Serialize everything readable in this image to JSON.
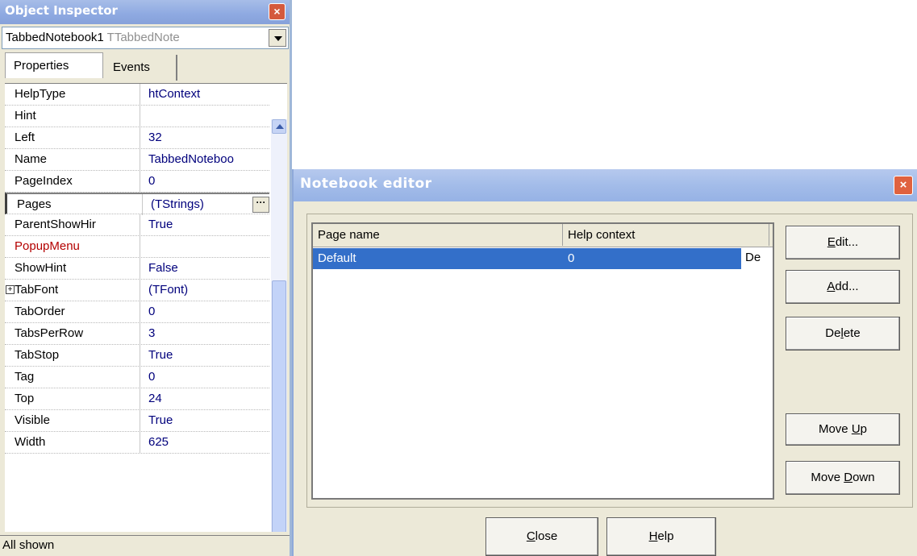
{
  "object_inspector": {
    "title": "Object Inspector",
    "close_glyph": "×",
    "component_name": "TabbedNotebook1",
    "component_type": "TTabbedNote",
    "tabs": [
      "Properties",
      "Events"
    ],
    "properties": [
      {
        "name": "HelpType",
        "value": "htContext"
      },
      {
        "name": "Hint",
        "value": ""
      },
      {
        "name": "Left",
        "value": "32"
      },
      {
        "name": "Name",
        "value": "TabbedNoteboo"
      },
      {
        "name": "PageIndex",
        "value": "0"
      },
      {
        "name": "Pages",
        "value": "(TStrings)"
      },
      {
        "name": "ParentShowHir",
        "value": "True"
      },
      {
        "name": "PopupMenu",
        "value": ""
      },
      {
        "name": "ShowHint",
        "value": "False"
      },
      {
        "name": "TabFont",
        "value": "(TFont)"
      },
      {
        "name": "TabOrder",
        "value": "0"
      },
      {
        "name": "TabsPerRow",
        "value": "3"
      },
      {
        "name": "TabStop",
        "value": "True"
      },
      {
        "name": "Tag",
        "value": "0"
      },
      {
        "name": "Top",
        "value": "24"
      },
      {
        "name": "Visible",
        "value": "True"
      },
      {
        "name": "Width",
        "value": "625"
      }
    ],
    "status": "All shown"
  },
  "notebook_editor": {
    "title": "Notebook editor",
    "close_glyph": "×",
    "columns": [
      "Page name",
      "Help context"
    ],
    "rows": [
      {
        "page_name": "Default",
        "help_context": "0"
      }
    ],
    "overflow_text": "De",
    "buttons": {
      "edit": {
        "mnemonic": "E",
        "rest": "dit..."
      },
      "add": {
        "mnemonic": "A",
        "rest": "dd..."
      },
      "delete": {
        "before": "De",
        "mnemonic": "l",
        "rest": "ete"
      },
      "move_up": {
        "before": "Move ",
        "mnemonic": "U",
        "rest": "p"
      },
      "move_down": {
        "before": "Move ",
        "mnemonic": "D",
        "rest": "own"
      },
      "close": {
        "mnemonic": "C",
        "rest": "lose"
      },
      "help": {
        "mnemonic": "H",
        "rest": "elp"
      }
    }
  }
}
